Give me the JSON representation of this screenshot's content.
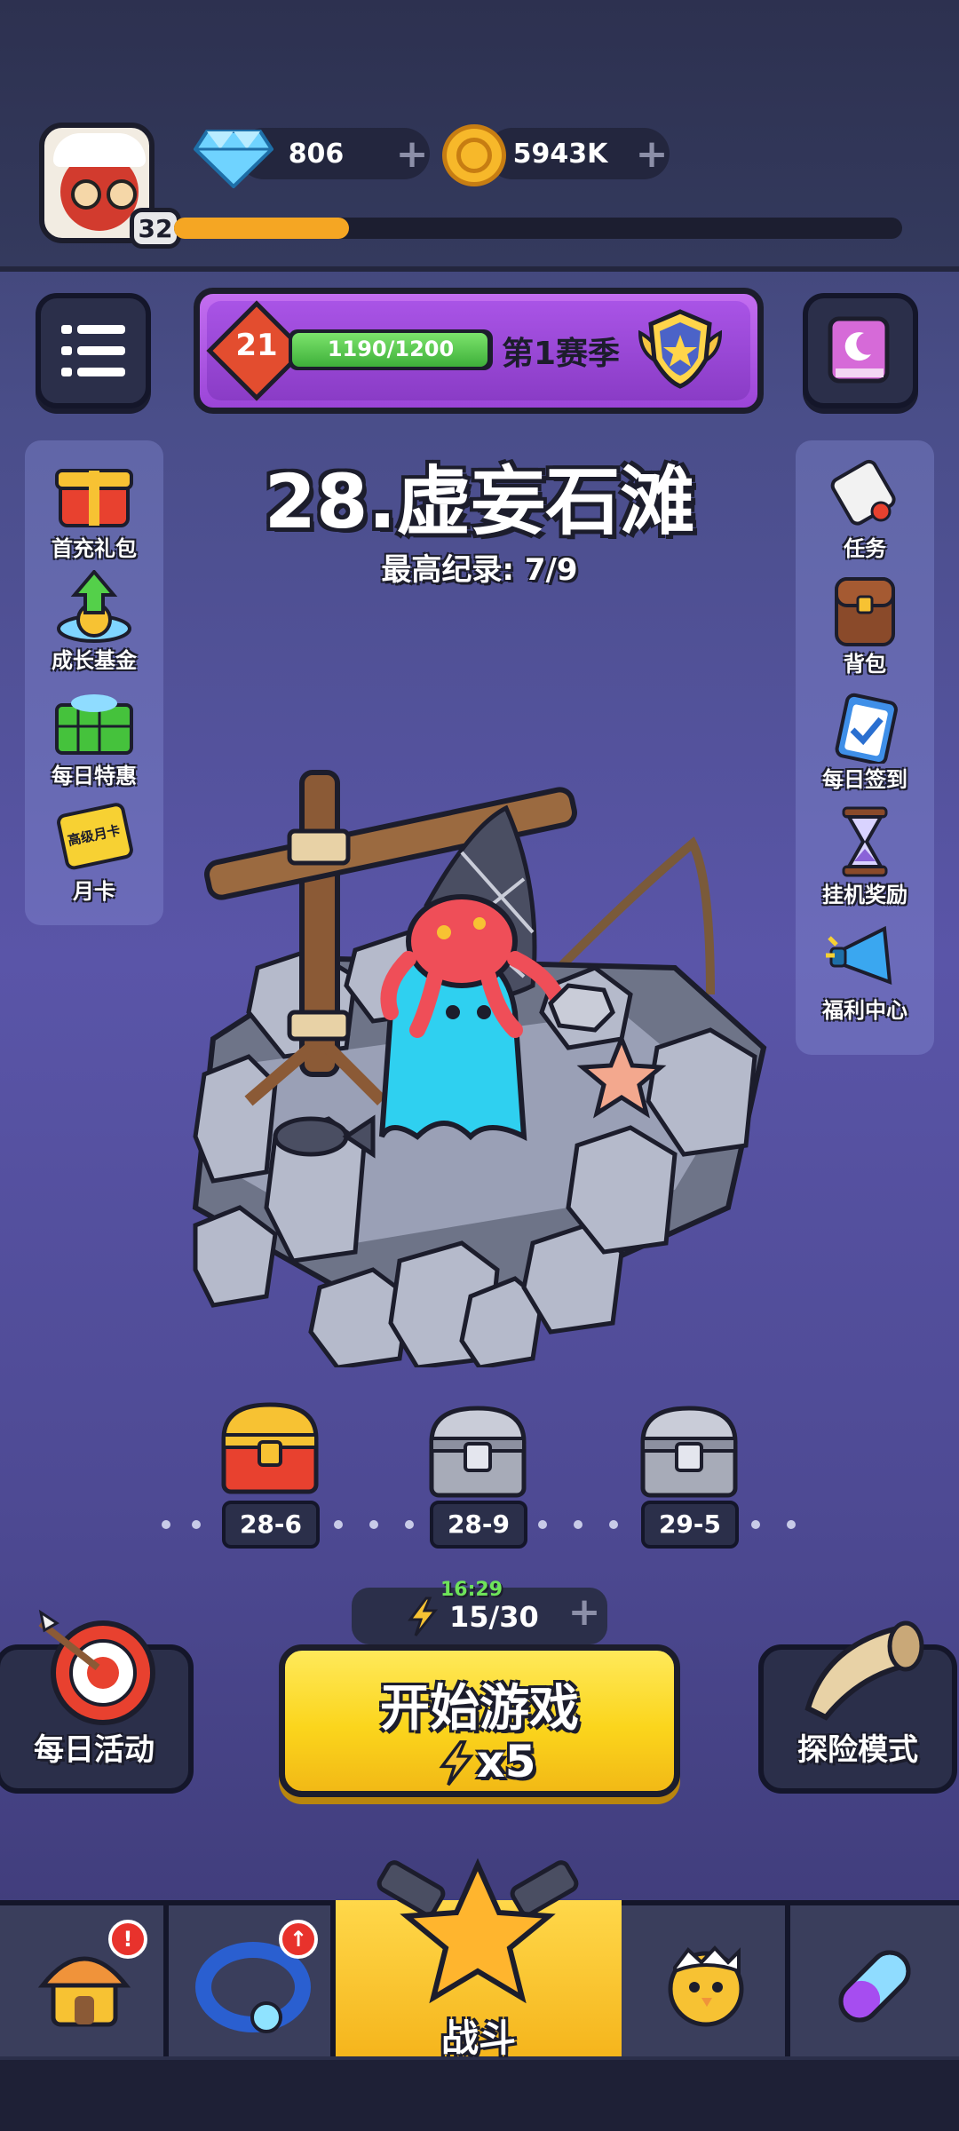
{
  "player": {
    "level": "32"
  },
  "currency": {
    "gems": "806",
    "gold": "5943K"
  },
  "season": {
    "rank": "21",
    "progress": "1190/1200",
    "label": "第1赛季",
    "progress_fraction": 0.99
  },
  "player_xp_fraction": 0.24,
  "stage": {
    "title": "28.虚妄石滩",
    "record": "最高纪录: 7/9"
  },
  "left_panel": [
    {
      "label": "首充礼包",
      "icon": "gift-box-icon"
    },
    {
      "label": "成长基金",
      "icon": "growth-fund-icon"
    },
    {
      "label": "每日特惠",
      "icon": "basket-icon"
    },
    {
      "label": "月卡",
      "icon": "month-card-icon",
      "card_text": "高级月卡"
    }
  ],
  "right_panel": [
    {
      "label": "任务",
      "icon": "scroll-icon"
    },
    {
      "label": "背包",
      "icon": "backpack-icon"
    },
    {
      "label": "每日签到",
      "icon": "clipboard-check-icon"
    },
    {
      "label": "挂机奖励",
      "icon": "hourglass-icon"
    },
    {
      "label": "福利中心",
      "icon": "megaphone-icon"
    }
  ],
  "chests": [
    {
      "label": "28-6",
      "type": "gold"
    },
    {
      "label": "28-9",
      "type": "silver"
    },
    {
      "label": "29-5",
      "type": "silver"
    }
  ],
  "energy": {
    "timer": "16:29",
    "count": "15/30"
  },
  "start_button": {
    "label": "开始游戏",
    "cost": "x5"
  },
  "daily_activity": {
    "label": "每日活动"
  },
  "adventure_mode": {
    "label": "探险模式"
  },
  "nav": {
    "active_label": "战斗",
    "badge_shop": "!"
  },
  "colors": {
    "accent": "#fbd51c",
    "season_purple": "#a954e6",
    "gold": "#f5a623"
  }
}
